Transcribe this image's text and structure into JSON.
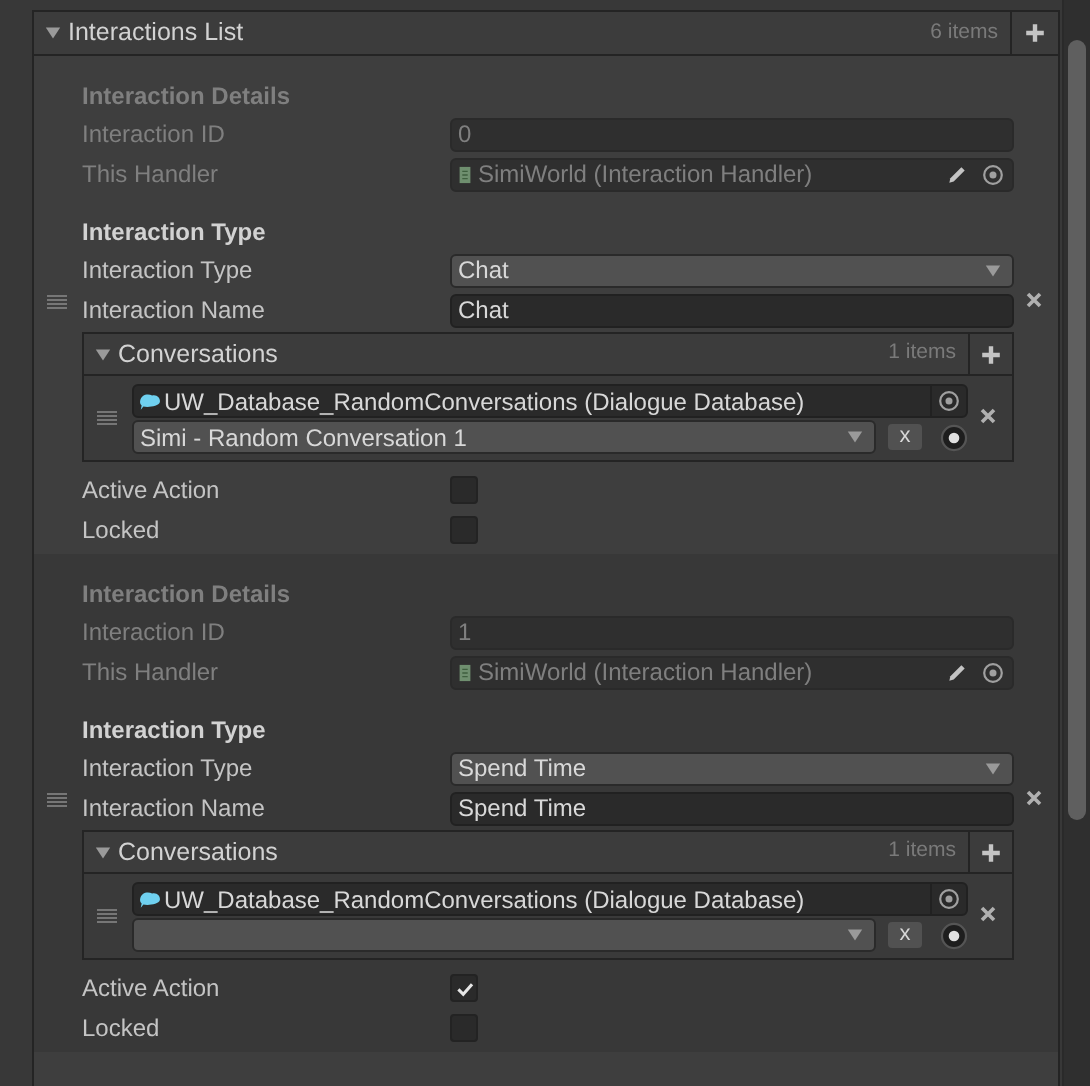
{
  "list": {
    "title": "Interactions List",
    "count": "6 items",
    "elements": [
      {
        "details_header": "Interaction Details",
        "id_label": "Interaction ID",
        "id": "0",
        "handler_label": "This Handler",
        "handler": "SimiWorld (Interaction Handler)",
        "type_header": "Interaction Type",
        "type_label": "Interaction Type",
        "type": "Chat",
        "name_label": "Interaction Name",
        "name": "Chat",
        "conversations": {
          "title": "Conversations",
          "count": "1 items",
          "items": [
            {
              "database": "UW_Database_RandomConversations (Dialogue Database)",
              "conversation": "Simi - Random Conversation 1",
              "clear": "x",
              "picker_on": true
            }
          ]
        },
        "active_label": "Active Action",
        "active": false,
        "locked_label": "Locked",
        "locked": false
      },
      {
        "details_header": "Interaction Details",
        "id_label": "Interaction ID",
        "id": "1",
        "handler_label": "This Handler",
        "handler": "SimiWorld (Interaction Handler)",
        "type_header": "Interaction Type",
        "type_label": "Interaction Type",
        "type": "Spend Time",
        "name_label": "Interaction Name",
        "name": "Spend Time",
        "conversations": {
          "title": "Conversations",
          "count": "1 items",
          "items": [
            {
              "database": "UW_Database_RandomConversations (Dialogue Database)",
              "clear": "x",
              "picker_on": true
            }
          ]
        },
        "active_label": "Active Action",
        "active": true,
        "locked_label": "Locked",
        "locked": false
      }
    ]
  }
}
